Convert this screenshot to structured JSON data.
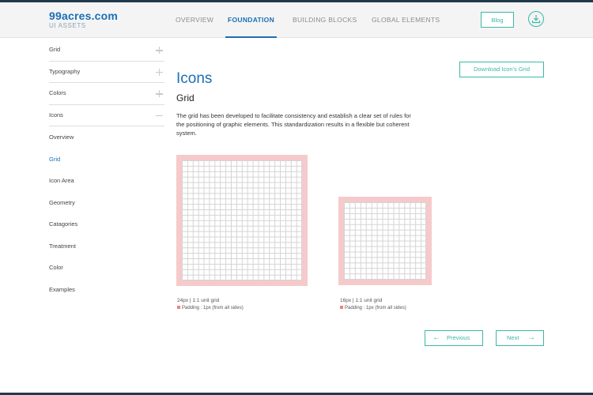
{
  "logo": {
    "name": "99acres.com",
    "subtitle": "UI ASSETS"
  },
  "nav": {
    "items": [
      {
        "label": "OVERVIEW"
      },
      {
        "label": "FOUNDATION"
      },
      {
        "label": "BUILDING BLOCKS"
      },
      {
        "label": "GLOBAL ELEMENTS"
      }
    ],
    "active": "FOUNDATION"
  },
  "header": {
    "blog_label": "Blog",
    "download_icon": "download-icon"
  },
  "sidebar": {
    "sections": [
      {
        "label": "Grid",
        "icon": "plus-icon"
      },
      {
        "label": "Typography",
        "icon": "plus-icon"
      },
      {
        "label": "Colors",
        "icon": "plus-icon"
      },
      {
        "label": "Icons",
        "icon": "minus-icon"
      }
    ],
    "sub_items": [
      {
        "label": "Overview"
      },
      {
        "label": "Grid"
      },
      {
        "label": "Icon Area"
      },
      {
        "label": "Geometry"
      },
      {
        "label": "Catagories"
      },
      {
        "label": "Treatment"
      },
      {
        "label": "Color"
      },
      {
        "label": "Examples"
      }
    ],
    "active_sub": "Grid"
  },
  "main": {
    "title": "Icons",
    "download_button": "Download Icon's Grid",
    "section_title": "Grid",
    "description": "The grid has been developed to facilitate consistency and establish a clear set of rules for the positioning of graphic elements. This standardization results in a flexible but coherent system.",
    "grids": [
      {
        "caption": "24px  |  1:1 unit grid",
        "padding_note": "Padding : 1px (from all sides)"
      },
      {
        "caption": "16px  |  1:1 unit grid",
        "padding_note": "Padding : 1px (from all sides)"
      }
    ]
  },
  "pager": {
    "previous": "Previous",
    "next": "Next"
  },
  "colors": {
    "accent": "#1b6fb6",
    "teal": "#3bb8a8",
    "padding": "#f6caca"
  }
}
